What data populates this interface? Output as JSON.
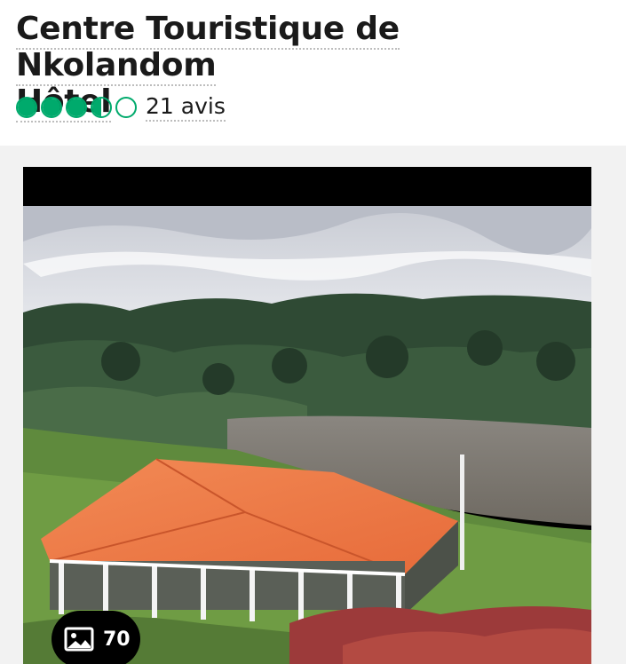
{
  "hotel": {
    "title_line1": "Centre Touristique de Nkolandom",
    "title_line2": "Hôtel"
  },
  "rating": {
    "value": 3.5,
    "max": 5,
    "reviews_label": "21 avis",
    "bubble_color": "#00aa6c"
  },
  "gallery": {
    "photo_count": "70",
    "photo_icon": "image-icon"
  }
}
